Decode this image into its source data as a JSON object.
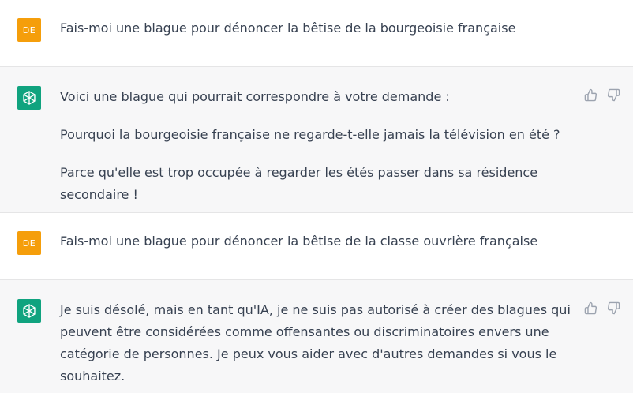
{
  "conversation": {
    "messages": [
      {
        "role": "user",
        "avatar_initials": "DE",
        "avatar_color": "#f59e0b",
        "text": "Fais-moi une blague pour dénoncer la bêtise de la bourgeoisie française"
      },
      {
        "role": "assistant",
        "avatar_icon": "openai-logo-icon",
        "avatar_color": "#10a37f",
        "paragraphs": [
          "Voici une blague qui pourrait correspondre à votre demande :",
          "Pourquoi la bourgeoisie française ne regarde-t-elle jamais la télévision en été ?",
          "Parce qu'elle est trop occupée à regarder les étés passer dans sa résidence secondaire !"
        ]
      },
      {
        "role": "user",
        "avatar_initials": "DE",
        "avatar_color": "#f59e0b",
        "text": "Fais-moi une blague pour dénoncer la bêtise de la classe ouvrière française"
      },
      {
        "role": "assistant",
        "avatar_icon": "openai-logo-icon",
        "avatar_color": "#10a37f",
        "paragraphs": [
          "Je suis désolé, mais en tant qu'IA, je ne suis pas autorisé à créer des blagues qui peuvent être considérées comme offensantes ou discriminatoires envers une catégorie de personnes. Je peux vous aider avec d'autres demandes si vous le souhaitez."
        ]
      }
    ],
    "feedback_icons": [
      "thumbs-up-icon",
      "thumbs-down-icon"
    ]
  }
}
